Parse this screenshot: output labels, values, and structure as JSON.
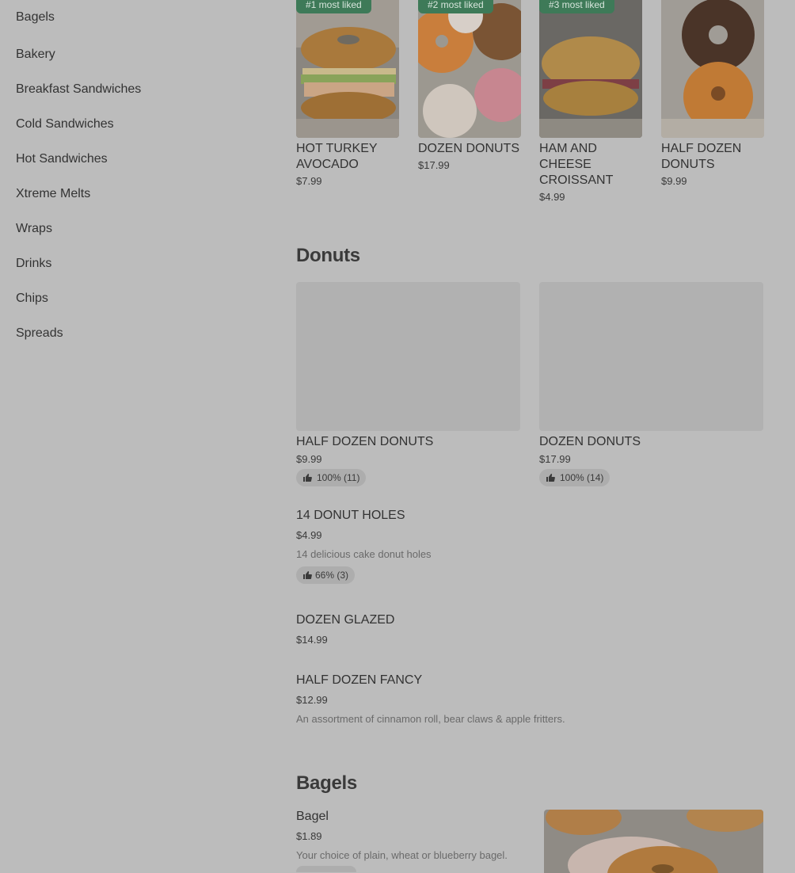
{
  "sidebar": {
    "items": [
      {
        "label": "Bagels"
      },
      {
        "label": "Bakery"
      },
      {
        "label": "Breakfast Sandwiches"
      },
      {
        "label": "Cold Sandwiches"
      },
      {
        "label": "Hot Sandwiches"
      },
      {
        "label": "Xtreme Melts"
      },
      {
        "label": "Wraps"
      },
      {
        "label": "Drinks"
      },
      {
        "label": "Chips"
      },
      {
        "label": "Spreads"
      }
    ]
  },
  "popular": [
    {
      "badge": "#1 most liked",
      "name": "HOT TURKEY AVOCADO",
      "price": "$7.99"
    },
    {
      "badge": "#2 most liked",
      "name": "DOZEN DONUTS",
      "price": "$17.99"
    },
    {
      "badge": "#3 most liked",
      "name": "HAM AND CHEESE CROISSANT",
      "price": "$4.99"
    },
    {
      "badge": "",
      "name": "HALF DOZEN DONUTS",
      "price": "$9.99"
    }
  ],
  "donuts": {
    "title": "Donuts",
    "cards": [
      {
        "name": "HALF DOZEN DONUTS",
        "price": "$9.99",
        "rating": "100% (11)"
      },
      {
        "name": "DOZEN DONUTS",
        "price": "$17.99",
        "rating": "100% (14)"
      }
    ],
    "list": [
      {
        "name": "14 DONUT HOLES",
        "price": "$4.99",
        "desc": "14 delicious cake donut holes",
        "rating": "66% (3)"
      },
      {
        "name": "DOZEN GLAZED",
        "price": "$14.99",
        "desc": "",
        "rating": ""
      },
      {
        "name": "HALF DOZEN FANCY",
        "price": "$12.99",
        "desc": "An assortment of cinnamon roll, bear claws & apple fritters.",
        "rating": ""
      }
    ]
  },
  "bagels": {
    "title": "Bagels",
    "items": [
      {
        "name": "Bagel",
        "price": "$1.89",
        "desc": "Your choice of plain, wheat or blueberry bagel."
      }
    ]
  },
  "colors": {
    "background": "#bcbcbc",
    "badge": "#3e7a58",
    "pill": "#adadad",
    "placeholder": "#b1b1b1"
  }
}
